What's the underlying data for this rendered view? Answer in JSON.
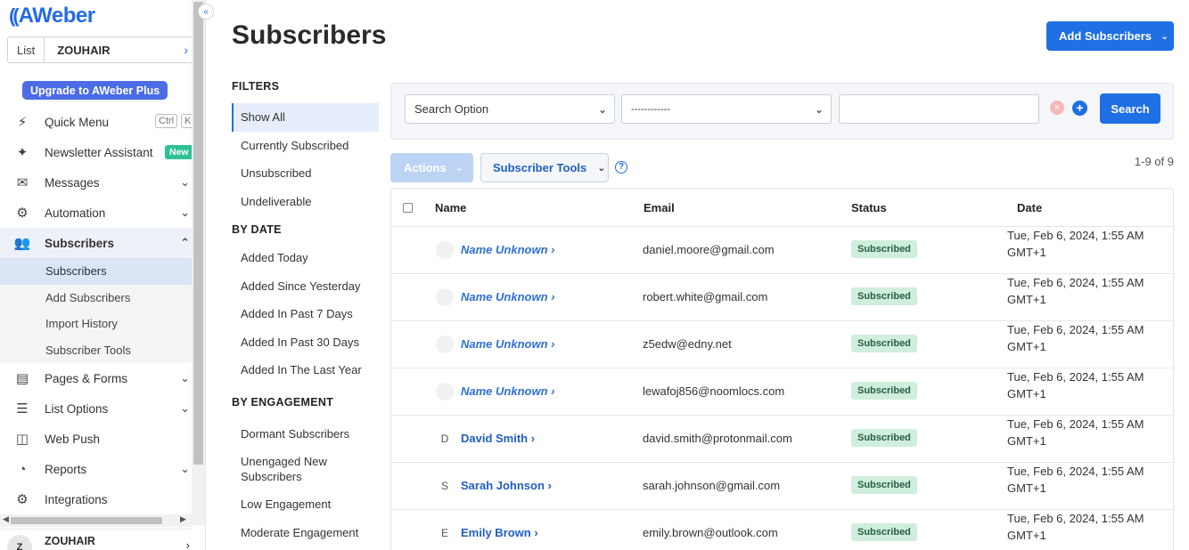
{
  "brand": {
    "logo_mark": "((",
    "logo_text": "AWeber"
  },
  "sidebar": {
    "collapse_icon": "«",
    "list": {
      "label": "List",
      "value": "ZOUHAIR"
    },
    "upgrade_label": "Upgrade to AWeber Plus",
    "quick_menu": {
      "label": "Quick Menu",
      "key1": "Ctrl",
      "key2": "K"
    },
    "newsletter": {
      "label": "Newsletter Assistant",
      "badge": "New"
    },
    "messages": "Messages",
    "automation": "Automation",
    "subscribers": "Subscribers",
    "sub_items": [
      "Subscribers",
      "Add Subscribers",
      "Import History",
      "Subscriber Tools"
    ],
    "pages_forms": "Pages & Forms",
    "list_options": "List Options",
    "web_push": "Web Push",
    "reports": "Reports",
    "integrations": "Integrations",
    "user": {
      "initial": "Z",
      "name": "ZOUHAIR"
    }
  },
  "page": {
    "title": "Subscribers",
    "add_button": "Add Subscribers"
  },
  "filters": {
    "heading": "FILTERS",
    "items": [
      "Show All",
      "Currently Subscribed",
      "Unsubscribed",
      "Undeliverable"
    ],
    "by_date_heading": "BY DATE",
    "by_date": [
      "Added Today",
      "Added Since Yesterday",
      "Added In Past 7 Days",
      "Added In Past 30 Days",
      "Added In The Last Year"
    ],
    "by_engagement_heading": "BY ENGAGEMENT",
    "by_engagement": [
      "Dormant Subscribers",
      "Unengaged New Subscribers",
      "Low Engagement",
      "Moderate Engagement"
    ]
  },
  "search": {
    "option_select": "Search Option",
    "operator_select": "------------",
    "value": "",
    "button": "Search"
  },
  "toolbar": {
    "actions": "Actions",
    "tools": "Subscriber Tools",
    "count": "1-9 of 9"
  },
  "table": {
    "headers": {
      "name": "Name",
      "email": "Email",
      "status": "Status",
      "date": "Date"
    },
    "rows": [
      {
        "initial": "",
        "name": "Name Unknown",
        "email": "daniel.moore@gmail.com",
        "status": "Subscribed",
        "date": "Tue, Feb 6, 2024, 1:55 AM GMT+1"
      },
      {
        "initial": "",
        "name": "Name Unknown",
        "email": "robert.white@gmail.com",
        "status": "Subscribed",
        "date": "Tue, Feb 6, 2024, 1:55 AM GMT+1"
      },
      {
        "initial": "",
        "name": "Name Unknown",
        "email": "z5edw@edny.net",
        "status": "Subscribed",
        "date": "Tue, Feb 6, 2024, 1:55 AM GMT+1"
      },
      {
        "initial": "",
        "name": "Name Unknown",
        "email": "lewafoj856@noomlocs.com",
        "status": "Subscribed",
        "date": "Tue, Feb 6, 2024, 1:55 AM GMT+1"
      },
      {
        "initial": "D",
        "name": "David Smith",
        "email": "david.smith@protonmail.com",
        "status": "Subscribed",
        "date": "Tue, Feb 6, 2024, 1:55 AM GMT+1"
      },
      {
        "initial": "S",
        "name": "Sarah Johnson",
        "email": "sarah.johnson@gmail.com",
        "status": "Subscribed",
        "date": "Tue, Feb 6, 2024, 1:55 AM GMT+1"
      },
      {
        "initial": "E",
        "name": "Emily Brown",
        "email": "emily.brown@outlook.com",
        "status": "Subscribed",
        "date": "Tue, Feb 6, 2024, 1:55 AM GMT+1"
      }
    ]
  },
  "colors": {
    "accent": "#1f6fe5",
    "badge_bg": "#cfeedd",
    "upgrade": "#4b6ce6"
  }
}
